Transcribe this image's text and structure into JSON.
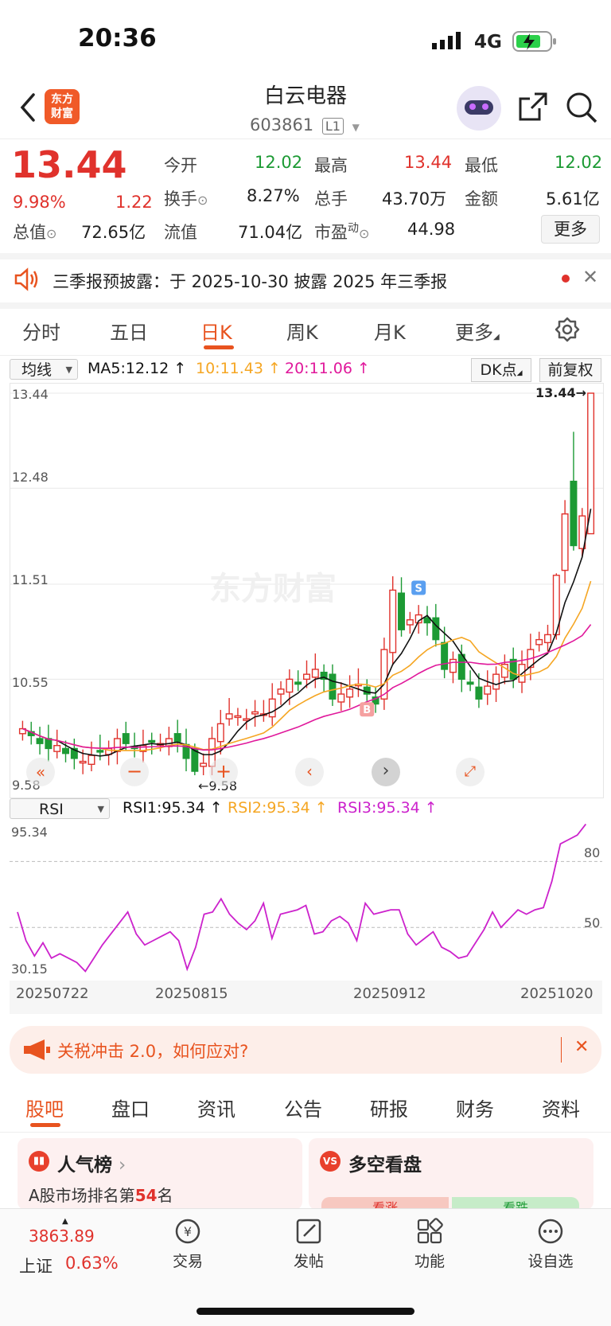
{
  "status": {
    "time": "20:36",
    "network": "4G"
  },
  "header": {
    "title": "白云电器",
    "code": "603861",
    "level": "L1"
  },
  "quote": {
    "price": "13.44",
    "change_pct": "9.98%",
    "change": "1.22",
    "open_label": "今开",
    "open": "12.02",
    "high_label": "最高",
    "high": "13.44",
    "low_label": "最低",
    "low": "12.02",
    "turnover_label": "换手",
    "turnover": "8.27%",
    "volume_label": "总手",
    "volume": "43.70万",
    "amount_label": "金额",
    "amount": "5.61亿",
    "mktcap_label": "总值",
    "mktcap": "72.65亿",
    "float_label": "流值",
    "float": "71.04亿",
    "pe_label": "市盈",
    "pe_sup": "动",
    "pe": "44.98",
    "more": "更多"
  },
  "notice": {
    "text": "三季报预披露：于 2025-10-30 披露 2025 年三季报"
  },
  "tabs": [
    "分时",
    "五日",
    "日K",
    "周K",
    "月K",
    "更多"
  ],
  "active_tab": 2,
  "indicator_bar": {
    "selector": "均线",
    "ma5": "MA5:12.12",
    "ma10": "10:11.43",
    "ma20": "20:11.06",
    "dk": "DK点",
    "adjust": "前复权"
  },
  "chart_data": {
    "type": "candlestick",
    "y_ticks": [
      "13.44",
      "12.48",
      "11.51",
      "10.55",
      "9.58"
    ],
    "ylim": [
      9.58,
      13.44
    ],
    "max_label": "13.44",
    "min_label": "9.58",
    "markers": [
      "B",
      "S"
    ],
    "watermark": "东方财富",
    "x_ticks": [
      "20250722",
      "20250815",
      "20250912",
      "20251020"
    ],
    "rsi": {
      "selector": "RSI",
      "rsi1": "RSI1:95.34",
      "rsi2": "RSI2:95.34",
      "rsi3": "RSI3:95.34",
      "y_top": "95.34",
      "y_bottom": "30.15",
      "levels": [
        "80",
        "50"
      ],
      "values": [
        57,
        44,
        37,
        43,
        36,
        38,
        36,
        34,
        30,
        36,
        42,
        47,
        52,
        57,
        47,
        42,
        44,
        46,
        48,
        44,
        31,
        41,
        56,
        57,
        63,
        56,
        52,
        49,
        53,
        61,
        45,
        56,
        57,
        58,
        60,
        47,
        48,
        53,
        55,
        52,
        44,
        61,
        56,
        57,
        58,
        58,
        47,
        42,
        45,
        48,
        41,
        39,
        36,
        37,
        43,
        49,
        57,
        50,
        54,
        58,
        56,
        58,
        59,
        71,
        88,
        90,
        92,
        97
      ]
    },
    "colors": {
      "up": "#e0322c",
      "down": "#1c9a34",
      "ma5": "#111111",
      "ma10": "#f5a623",
      "ma20": "#e0189b",
      "rsi": "#cc22cc"
    }
  },
  "ad_banner": {
    "text": "关税冲击 2.0，如何应对?"
  },
  "sub_tabs": [
    "股吧",
    "盘口",
    "资讯",
    "公告",
    "研报",
    "财务",
    "资料"
  ],
  "cards": {
    "popularity_title": "人气榜",
    "popularity_rank_prefix": "A股市场排名第",
    "popularity_rank": "54",
    "popularity_rank_suffix": "名",
    "bullbear_title": "多空看盘",
    "bull": "看涨",
    "bear": "看跌"
  },
  "bottom_nav": {
    "index_value": "3863.89",
    "index_name": "上证",
    "index_change": "0.63%",
    "items": [
      "交易",
      "发帖",
      "功能",
      "设自选"
    ]
  }
}
